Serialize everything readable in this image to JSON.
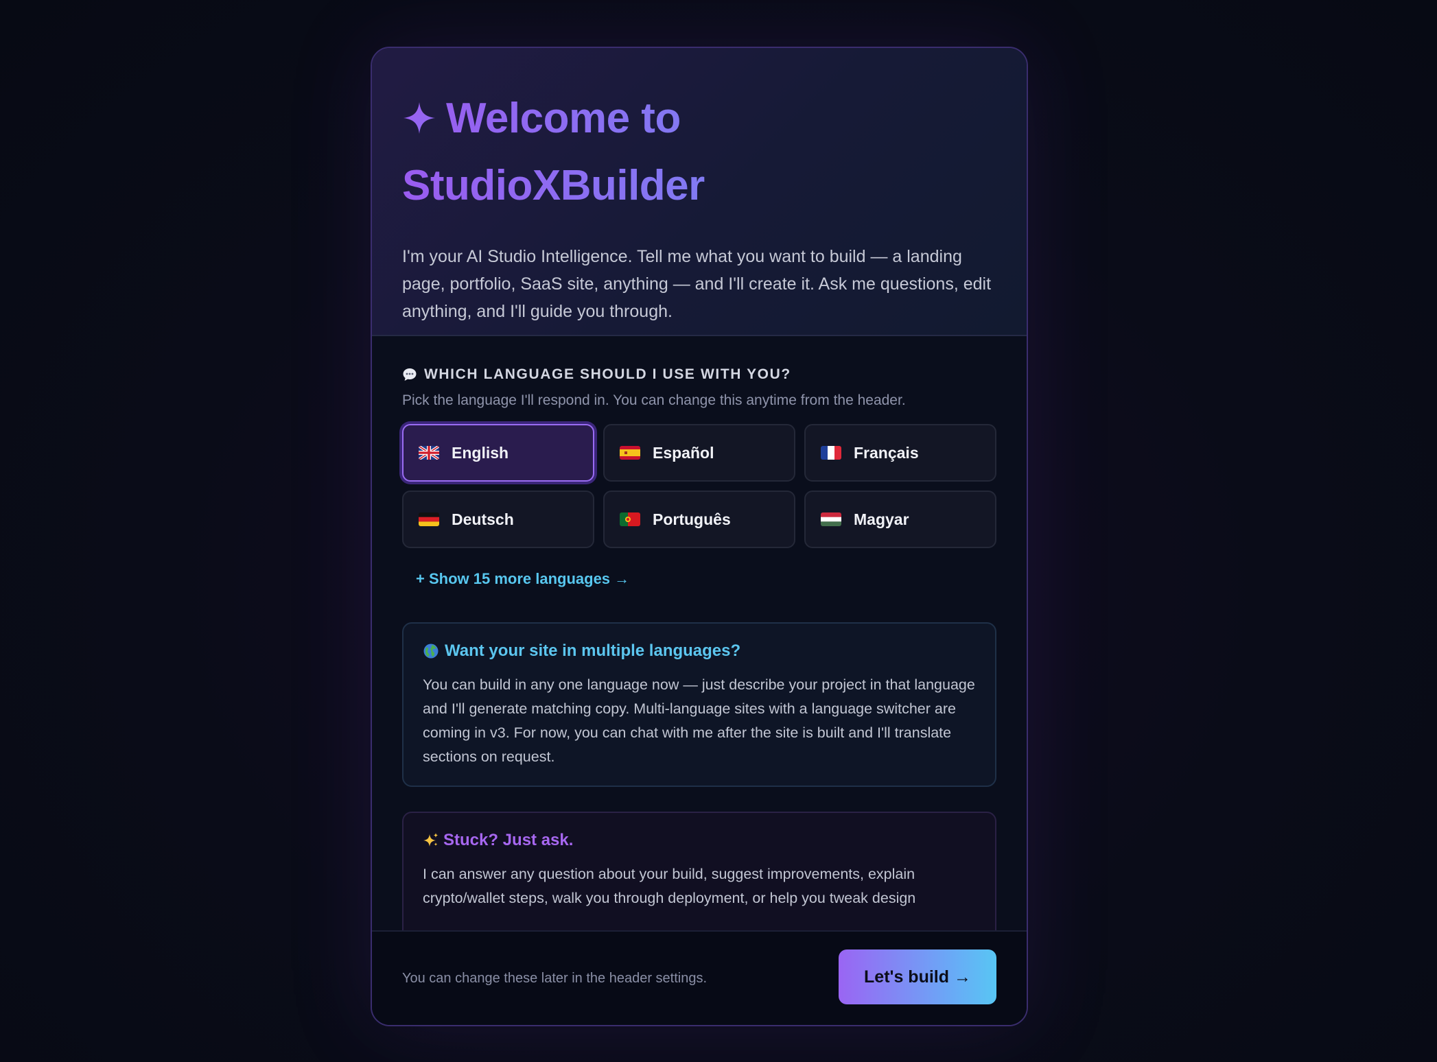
{
  "hero": {
    "title_line1": "Welcome to",
    "title_line2": "StudioXBuilder",
    "intro": "I'm your AI Studio Intelligence. Tell me what you want to build — a landing page, portfolio, SaaS site, anything — and I'll create it. Ask me questions, edit anything, and I'll guide you through."
  },
  "language": {
    "heading": "WHICH LANGUAGE SHOULD I USE WITH YOU?",
    "subtitle": "Pick the language I'll respond in. You can change this anytime from the header.",
    "options": [
      {
        "label": "English",
        "flag": "uk-flag-icon",
        "selected": true
      },
      {
        "label": "Español",
        "flag": "spain-flag-icon",
        "selected": false
      },
      {
        "label": "Français",
        "flag": "france-flag-icon",
        "selected": false
      },
      {
        "label": "Deutsch",
        "flag": "germany-flag-icon",
        "selected": false
      },
      {
        "label": "Português",
        "flag": "portugal-flag-icon",
        "selected": false
      },
      {
        "label": "Magyar",
        "flag": "hungary-flag-icon",
        "selected": false
      }
    ],
    "more_link": "+ Show 15 more languages →"
  },
  "multilang_card": {
    "icon": "globe-icon",
    "title": "Want your site in multiple languages?",
    "body": "You can build in any one language now — just describe your project in that language and I'll generate matching copy. Multi-language sites with a language switcher are coming in v3. For now, you can chat with me after the site is built and I'll translate sections on request."
  },
  "help_card": {
    "icon": "sparkles-icon",
    "title": "Stuck? Just ask.",
    "body": "I can answer any question about your build, suggest improvements, explain crypto/wallet steps, walk you through deployment, or help you tweak design"
  },
  "footer": {
    "note": "You can change these later in the header settings.",
    "cta_label": "Let's build →"
  },
  "colors": {
    "accent_purple": "#9a5cf0",
    "accent_blue": "#6a9ff4",
    "link_cyan": "#58c7ef"
  }
}
